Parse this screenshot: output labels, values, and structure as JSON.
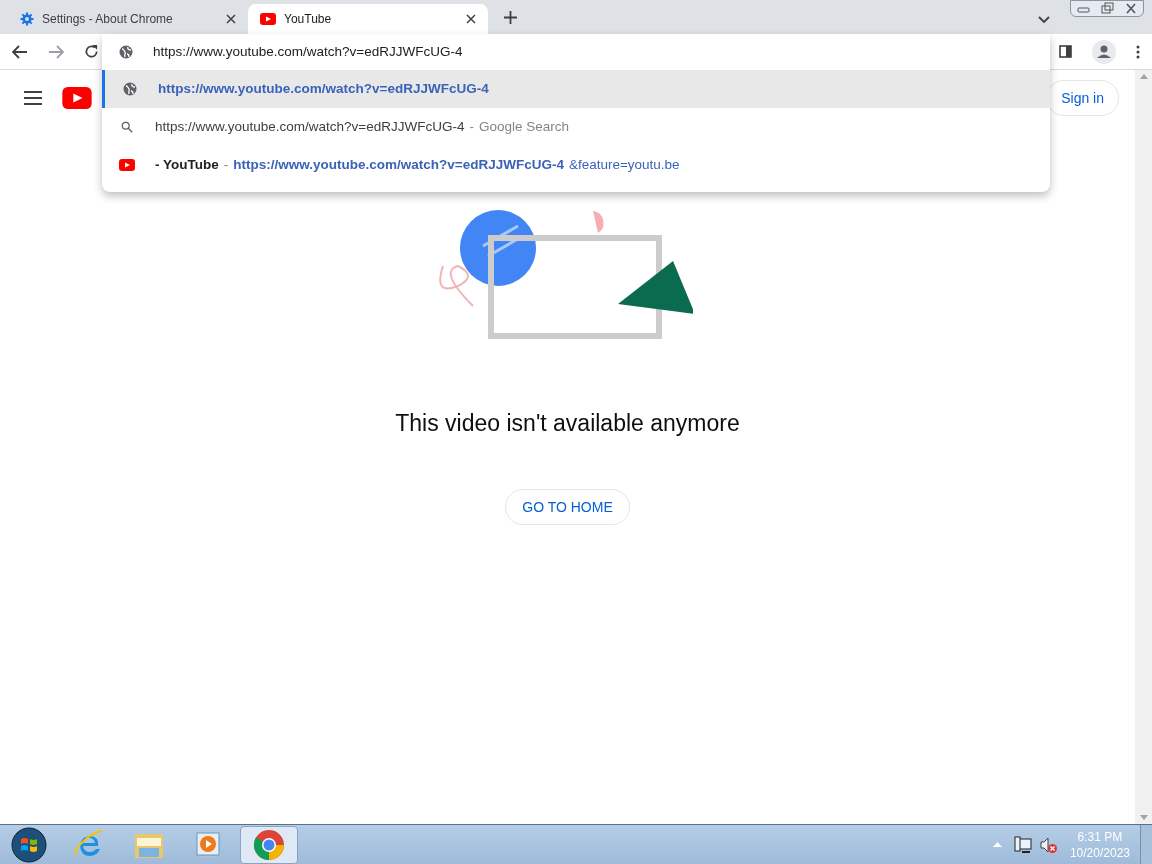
{
  "tabs": [
    {
      "label": "Settings - About Chrome",
      "kind": "gear",
      "selected": false
    },
    {
      "label": "YouTube",
      "kind": "youtube",
      "selected": true
    }
  ],
  "omnibox": {
    "value": "https://www.youtube.com/watch?v=edRJJWFcUG-4"
  },
  "suggestions": [
    {
      "kind": "globe",
      "selected": true,
      "parts": [
        {
          "kind": "match",
          "text": "https://www.youtube.com/watch?v=edRJJWFcUG-4"
        }
      ]
    },
    {
      "kind": "search",
      "selected": false,
      "parts": [
        {
          "kind": "plain",
          "text": "https://www.youtube.com/watch?v=edRJJWFcUG-4"
        },
        {
          "kind": "sep",
          "text": "-"
        },
        {
          "kind": "dim",
          "text": "Google Search"
        }
      ]
    },
    {
      "kind": "youtube",
      "selected": false,
      "parts": [
        {
          "kind": "title",
          "text": "- YouTube"
        },
        {
          "kind": "sep",
          "text": "-"
        },
        {
          "kind": "match",
          "text": "https://www.youtube.com/watch?v=edRJJWFcUG-4"
        },
        {
          "kind": "url",
          "text": "&feature=youtu.be"
        }
      ]
    }
  ],
  "page": {
    "sign_in": "Sign in",
    "message": "This video isn't available anymore",
    "button": "GO TO HOME"
  },
  "taskbar": {
    "items": [
      {
        "kind": "start",
        "selected": false
      },
      {
        "kind": "ie",
        "selected": false
      },
      {
        "kind": "explorer",
        "selected": false
      },
      {
        "kind": "media",
        "selected": false
      },
      {
        "kind": "chrome",
        "selected": true
      }
    ],
    "time": "6:31 PM",
    "date": "10/20/2023"
  }
}
